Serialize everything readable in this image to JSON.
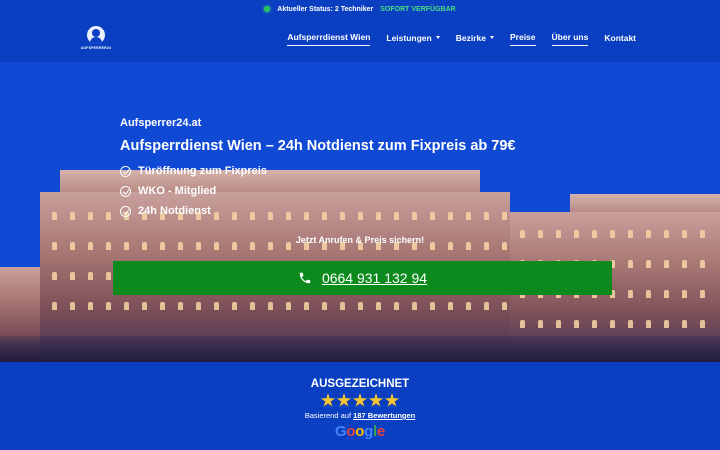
{
  "topbar": {
    "status_label": "Aktueller Status: 2 Techniker",
    "availability": "SOFORT VERFÜGBAR"
  },
  "logo": {
    "text": "AUFSPERRER24"
  },
  "nav": {
    "items": [
      {
        "label": "Aufsperrdienst Wien",
        "dropdown": false,
        "active": true
      },
      {
        "label": "Leistungen",
        "dropdown": true,
        "active": false
      },
      {
        "label": "Bezirke",
        "dropdown": true,
        "active": false
      },
      {
        "label": "Preise",
        "dropdown": false,
        "active": true
      },
      {
        "label": "Über uns",
        "dropdown": false,
        "active": true
      },
      {
        "label": "Kontakt",
        "dropdown": false,
        "active": false
      }
    ]
  },
  "hero": {
    "brand": "Aufsperrer24.at",
    "headline": "Aufsperrdienst Wien – 24h Notdienst zum Fixpreis ab 79€",
    "features": [
      "Türöffnung zum Fixpreis",
      "WKO - Mitglied",
      "24h Notdienst"
    ],
    "cta_note": "Jetzt Anrufen & Preis sichern!",
    "phone": "0664 931 132 94"
  },
  "reviews": {
    "title": "AUSGEZEICHNET",
    "based_prefix": "Basierend auf",
    "count_link": "187 Bewertungen",
    "rating_stars": 5,
    "provider": "Google"
  },
  "colors": {
    "brand_blue": "#0b3fc2",
    "cta_green": "#0d8a1e",
    "status_green": "#4ade80",
    "star_yellow": "#f4c430"
  }
}
